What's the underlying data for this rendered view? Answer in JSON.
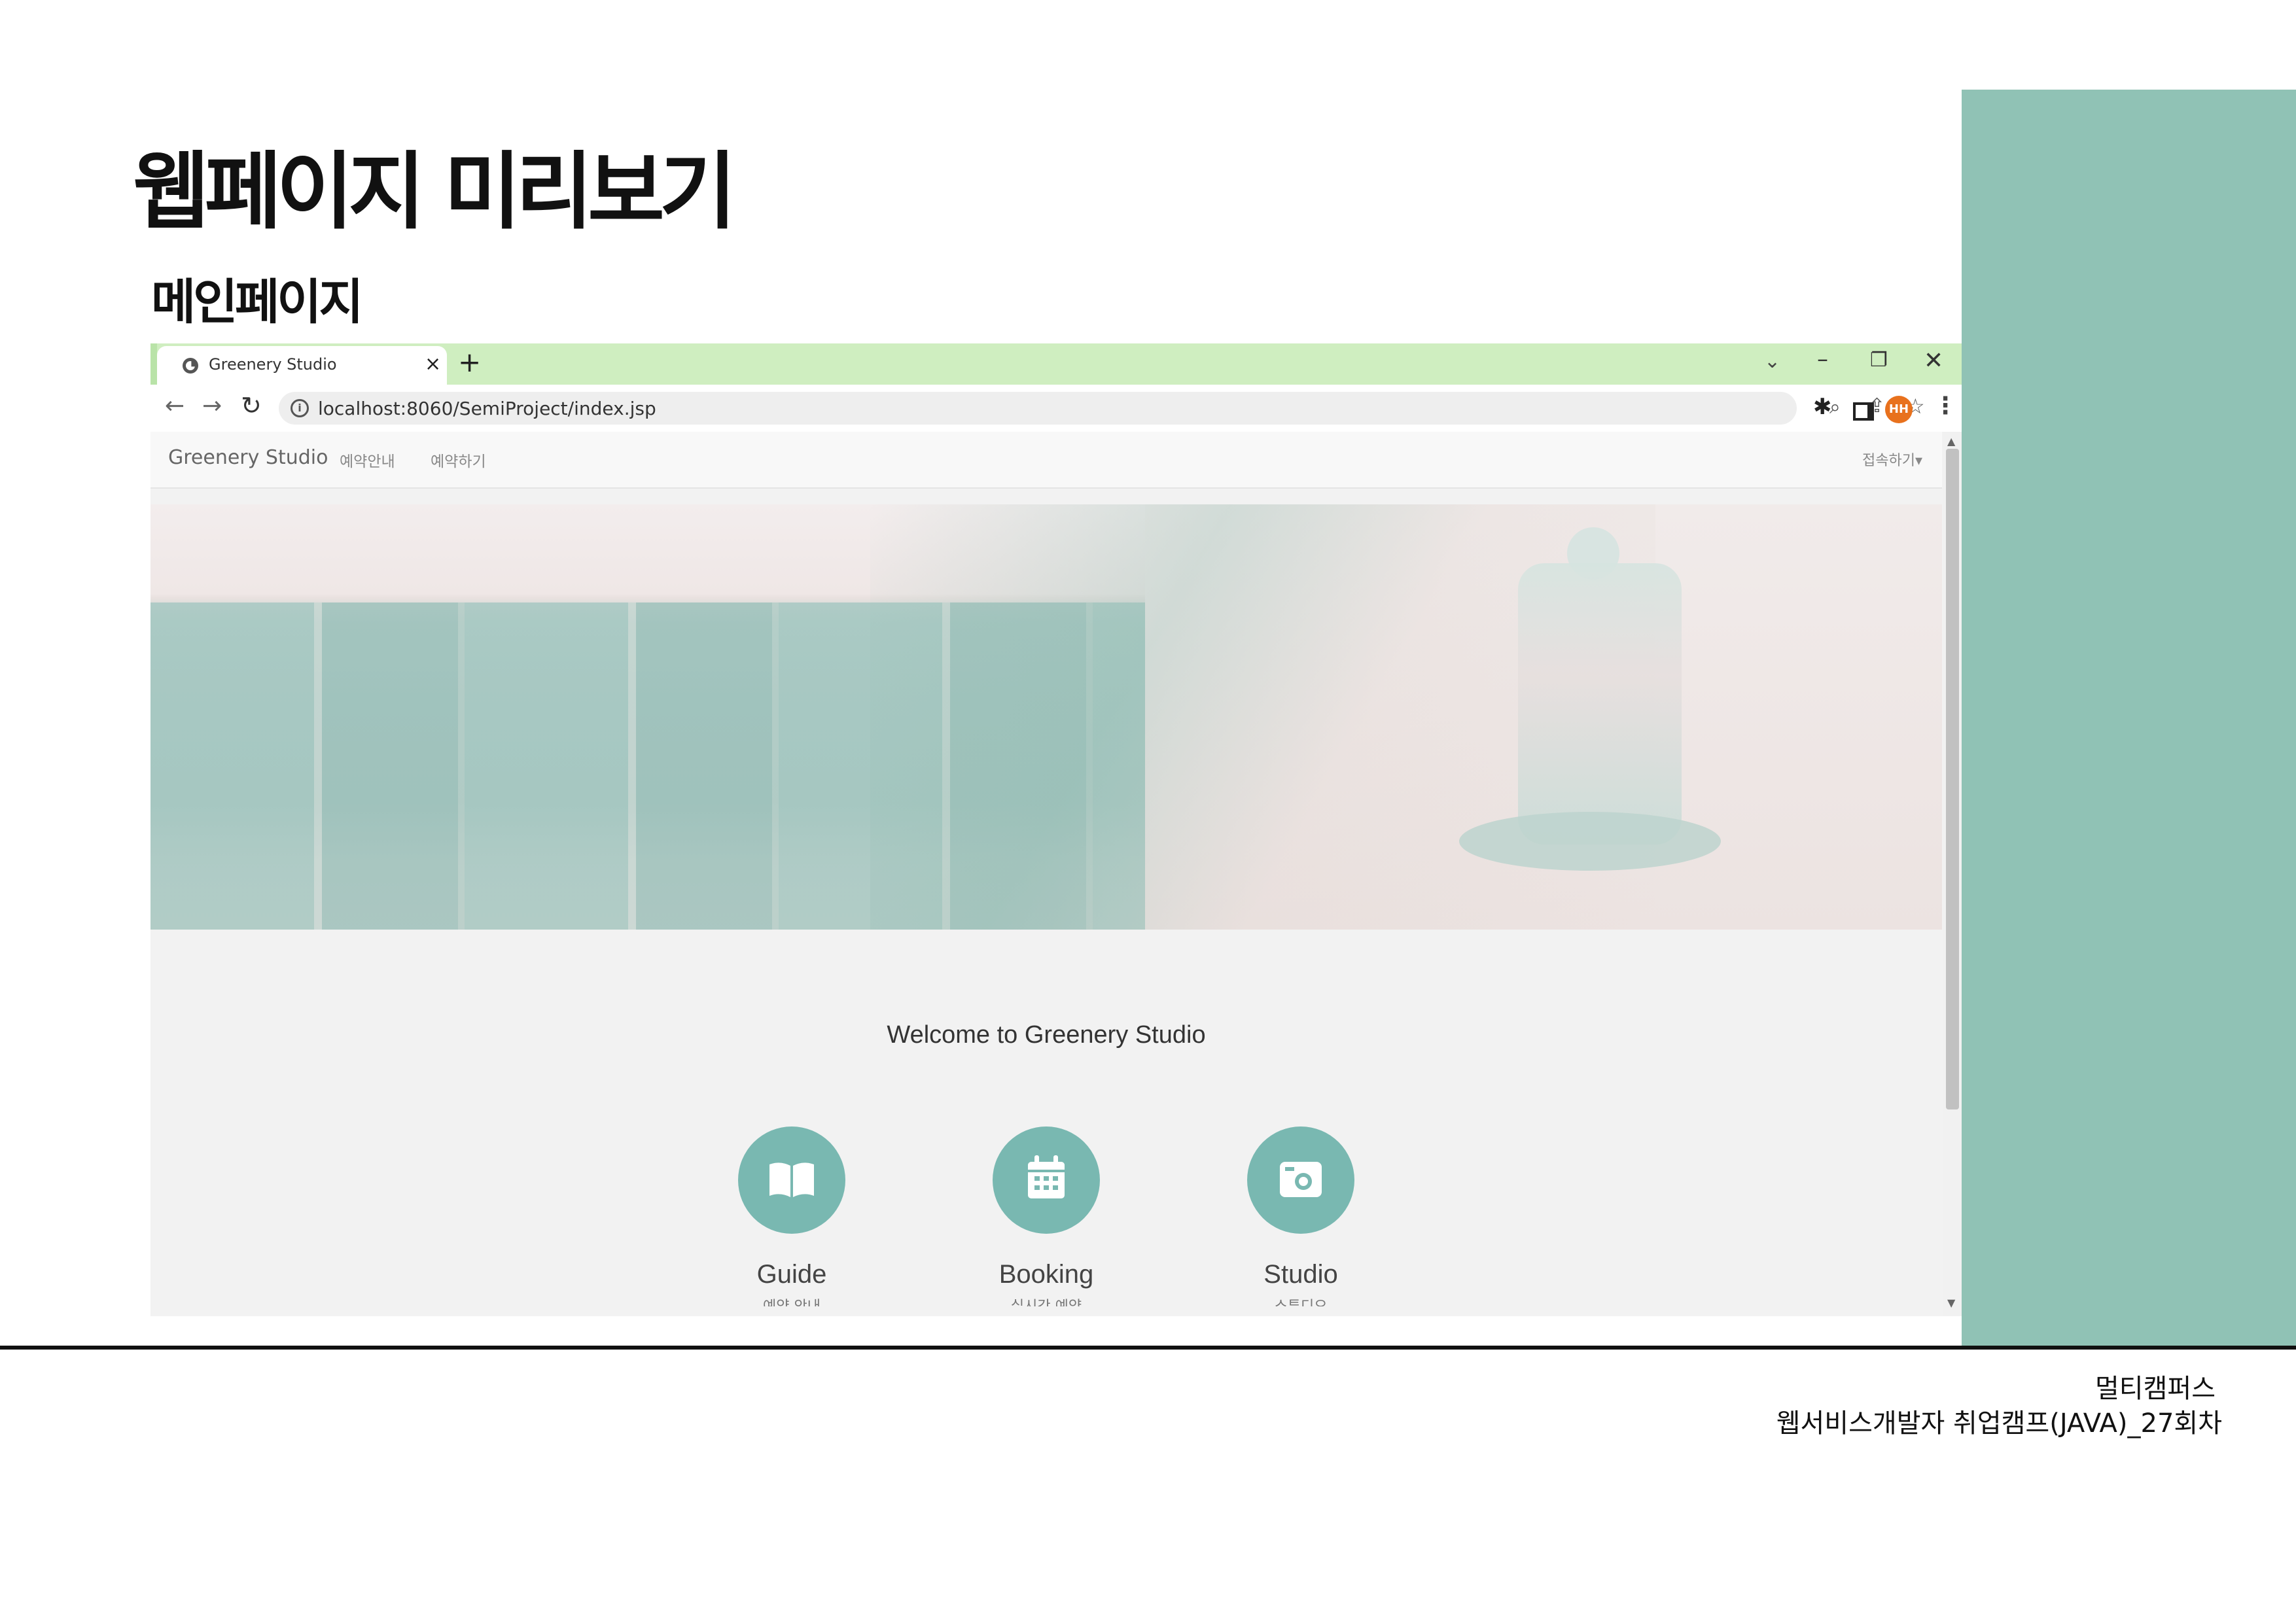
{
  "slide": {
    "title": "웹페이지 미리보기",
    "subtitle": "메인페이지",
    "footer_line1": "멀티캠퍼스",
    "footer_line2": "웹서비스개발자 취업캠프(JAVA)_27회차",
    "accent_color": "#90c2b5"
  },
  "browser": {
    "tab_title": "Greenery Studio",
    "tab_close": "×",
    "new_tab": "+",
    "url": "localhost:8060/SemiProject/index.jsp",
    "avatar_initials": "HH",
    "tabstrip_color": "#cfeec0",
    "avatar_color": "#e8711d"
  },
  "page": {
    "brand": "Greenery Studio",
    "nav_links": [
      "예약안내",
      "예약하기"
    ],
    "nav_right": "접속하기▾",
    "welcome": "Welcome to Greenery Studio",
    "features": [
      {
        "title": "Guide",
        "subtitle": "예약 안내",
        "icon": "book-icon"
      },
      {
        "title": "Booking",
        "subtitle": "실시간 예약",
        "icon": "calendar-icon"
      },
      {
        "title": "Studio",
        "subtitle": "스튜디오",
        "icon": "camera-icon"
      }
    ],
    "feature_color": "#79b8b1"
  }
}
